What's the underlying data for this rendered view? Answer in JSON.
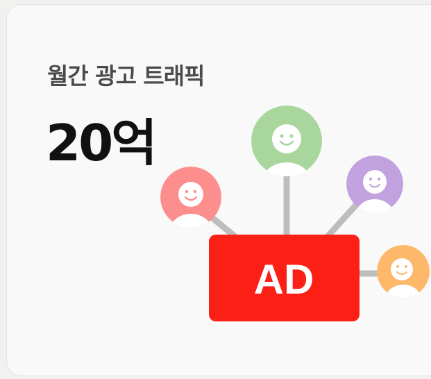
{
  "card": {
    "title": "월간 광고 트래픽",
    "value": "20억"
  },
  "illustration": {
    "ad_label": "AD",
    "ad_color": "#fb1f16",
    "connector_color": "#bdbdbd",
    "avatars": [
      {
        "name": "green",
        "color": "#a8d69d",
        "icon": "smiley-face-icon"
      },
      {
        "name": "red",
        "color": "#fc8f8e",
        "icon": "smiley-face-icon"
      },
      {
        "name": "purple",
        "color": "#c1a2de",
        "icon": "smiley-face-icon"
      },
      {
        "name": "orange",
        "color": "#fdb86a",
        "icon": "smiley-face-icon"
      }
    ]
  }
}
